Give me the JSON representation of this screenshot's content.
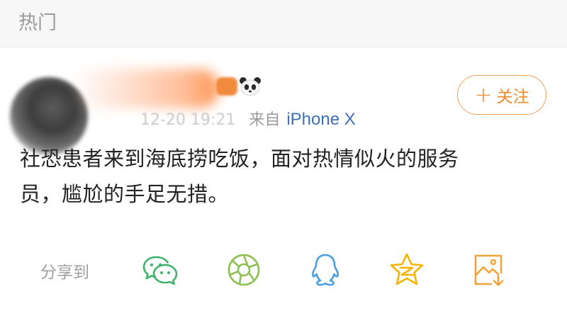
{
  "section": {
    "title": "热门"
  },
  "post": {
    "username": "",
    "meta": {
      "time": "12-20 19:21",
      "from_label": "来自",
      "device": "iPhone X"
    },
    "follow": {
      "plus": "+",
      "label": "关注"
    },
    "text_line1": "社恐患者来到海底捞吃饭，面对热情似火的服务",
    "text_line2": "员，尴尬的手足无措。"
  },
  "share": {
    "label": "分享到",
    "targets": [
      {
        "name": "wechat-icon",
        "color": "#3fb26b"
      },
      {
        "name": "moments-icon",
        "color": "#8cc152"
      },
      {
        "name": "qq-icon",
        "color": "#4a9de0"
      },
      {
        "name": "qzone-icon",
        "color": "#f5b400"
      },
      {
        "name": "save-image-icon",
        "color": "#f0a43c"
      }
    ]
  },
  "colors": {
    "accent": "#f08a2d",
    "link": "#3f6fb6",
    "text": "#222222",
    "muted": "#9e9e9e"
  }
}
